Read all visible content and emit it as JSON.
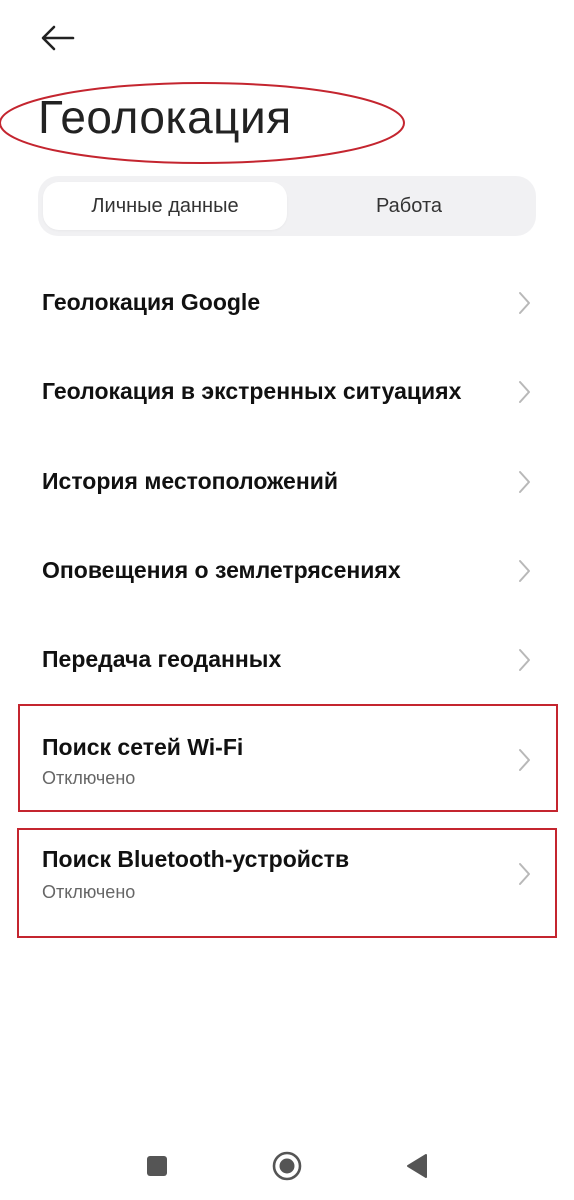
{
  "header": {
    "back_icon": "arrow-left-icon",
    "title": "Геолокация"
  },
  "tabs": [
    {
      "label": "Личные данные",
      "active": true
    },
    {
      "label": "Работа",
      "active": false
    }
  ],
  "menu": [
    {
      "label": "Геолокация Google",
      "subtitle": ""
    },
    {
      "label": "Геолокация в экстренных ситуациях",
      "subtitle": ""
    },
    {
      "label": "История местоположений",
      "subtitle": ""
    },
    {
      "label": "Оповещения о землетрясениях",
      "subtitle": ""
    },
    {
      "label": "Передача геоданных",
      "subtitle": ""
    },
    {
      "label": "Поиск сетей Wi-Fi",
      "subtitle": "Отключено"
    },
    {
      "label": "Поиск Bluetooth-устройств",
      "subtitle": "Отключено"
    }
  ],
  "nav": {
    "recents_icon": "square-icon",
    "home_icon": "circle-home-icon",
    "back_icon": "triangle-back-icon"
  },
  "colors": {
    "annotation_red": "#c4252f",
    "tab_bg": "#f1f1f3",
    "chevron": "#b8b8b8",
    "nav_icon": "#555555"
  }
}
